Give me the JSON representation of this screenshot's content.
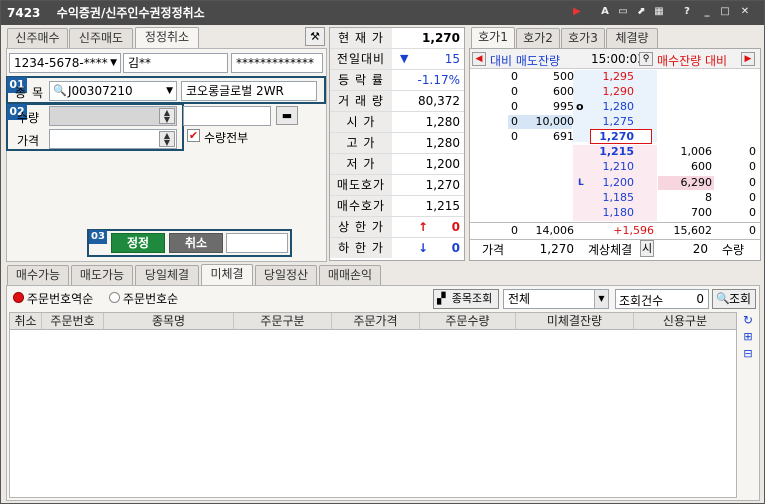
{
  "window": {
    "id": "7423",
    "title": "수익증권/신주인수권정정취소"
  },
  "order_tabs": [
    "신주매수",
    "신주매도",
    "정정취소"
  ],
  "account": {
    "number": "1234-5678-****",
    "name": "김**",
    "password": "*************"
  },
  "form": {
    "badge1": "01",
    "badge2": "02",
    "badge3": "03",
    "item_label": "종목",
    "item_code": "J00307210",
    "item_name": "코오롱글로벌 2WR",
    "qty_label": "수량",
    "price_label": "가격",
    "qty_all_label": "수량전부",
    "correct_button": "정정",
    "cancel_button": "취소"
  },
  "quote": {
    "rows": [
      {
        "label": "현 재 가",
        "value": "1,270",
        "color": "#000"
      },
      {
        "label": "전일대비",
        "value": "15",
        "arrow": "▼",
        "color": "#1a3fd1"
      },
      {
        "label": "등 락 률",
        "value": "-1.17%",
        "color": "#1a3fd1"
      },
      {
        "label": "거 래 량",
        "value": "80,372",
        "color": "#000"
      },
      {
        "label": "시    가",
        "value": "1,280",
        "color": "#000"
      },
      {
        "label": "고    가",
        "value": "1,280",
        "color": "#000"
      },
      {
        "label": "저    가",
        "value": "1,200",
        "color": "#000"
      },
      {
        "label": "매도호가",
        "value": "1,270",
        "color": "#000"
      },
      {
        "label": "매수호가",
        "value": "1,215",
        "color": "#000"
      },
      {
        "label": "상 한 가",
        "value": "0",
        "arrow": "↑",
        "color": "#d11"
      },
      {
        "label": "하 한 가",
        "value": "0",
        "arrow": "↓",
        "color": "#1a3fd1"
      }
    ]
  },
  "hoga": {
    "tabs": [
      "호가1",
      "호가2",
      "호가3",
      "체결량"
    ],
    "head_left": "대비  매도잔량",
    "time": "15:00:03",
    "head_right": "매수잔량  대비",
    "asks": [
      {
        "diff": "0",
        "qty": "500",
        "price": "1,295"
      },
      {
        "diff": "0",
        "qty": "600",
        "price": "1,290"
      },
      {
        "diff": "0",
        "qty": "995",
        "price": "1,280",
        "mark": "o"
      },
      {
        "diff": "0",
        "qty": "10,000",
        "price": "1,275"
      },
      {
        "diff": "0",
        "qty": "691",
        "price": "1,270"
      }
    ],
    "bids": [
      {
        "price": "1,215",
        "qty": "1,006",
        "diff": "0"
      },
      {
        "price": "1,210",
        "qty": "600",
        "diff": "0"
      },
      {
        "price": "1,200",
        "qty": "6,290",
        "diff": "0",
        "mark": "L"
      },
      {
        "price": "1,185",
        "qty": "8",
        "diff": "0"
      },
      {
        "price": "1,180",
        "qty": "700",
        "diff": "0"
      }
    ],
    "total": {
      "ask_diff": "0",
      "ask_qty": "14,006",
      "mid": "+1,596",
      "bid_qty": "15,602",
      "bid_diff": "0"
    },
    "footer": {
      "price_label": "가격",
      "price": "1,270",
      "calc_label": "계상체결",
      "calc_btn": "시",
      "qty": "20",
      "qty_label": "수량"
    }
  },
  "bottom_tabs": [
    "매수가능",
    "매도가능",
    "당일체결",
    "미체결",
    "당일정산",
    "매매손익"
  ],
  "sort": {
    "opt1": "주문번호역순",
    "opt2": "주문번호순"
  },
  "lookup": {
    "item_btn": "종목조회",
    "select": "전체",
    "count_label": "조회건수",
    "count": "0",
    "query_btn": "조회"
  },
  "grid_columns": [
    "취소",
    "주문번호",
    "종목명",
    "주문구분",
    "주문가격",
    "주문수량",
    "미체결잔량",
    "신용구분"
  ]
}
